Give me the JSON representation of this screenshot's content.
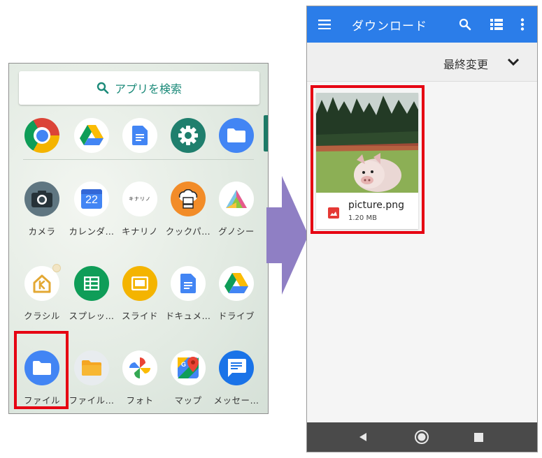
{
  "drawer": {
    "search_placeholder": "アプリを検索",
    "apps": [
      {
        "label": "カメラ",
        "icon": "camera-icon"
      },
      {
        "label": "カレンダ…",
        "icon": "calendar-icon",
        "date": "22"
      },
      {
        "label": "キナリノ",
        "icon": "kinarino-icon",
        "icon_text": "キナリノ"
      },
      {
        "label": "クックパ…",
        "icon": "cookpad-icon"
      },
      {
        "label": "グノシー",
        "icon": "gunosy-icon"
      },
      {
        "label": "クラシル",
        "icon": "kurashiru-icon"
      },
      {
        "label": "スプレッ…",
        "icon": "sheets-icon"
      },
      {
        "label": "スライド",
        "icon": "slides-icon"
      },
      {
        "label": "ドキュメ…",
        "icon": "docs-icon"
      },
      {
        "label": "ドライブ",
        "icon": "drive-icon"
      },
      {
        "label": "ファイル",
        "icon": "files-folder-icon"
      },
      {
        "label": "ファイル…",
        "icon": "file-manager-icon"
      },
      {
        "label": "フォト",
        "icon": "photos-icon"
      },
      {
        "label": "マップ",
        "icon": "maps-icon"
      },
      {
        "label": "メッセー…",
        "icon": "messages-icon"
      }
    ]
  },
  "files_app": {
    "title": "ダウンロード",
    "sort_label": "最終変更",
    "file": {
      "name": "picture.png",
      "size": "1.20 MB"
    }
  },
  "colors": {
    "appbar": "#2b7de9",
    "highlight": "#e60012",
    "arrow": "#8f7fc4"
  }
}
